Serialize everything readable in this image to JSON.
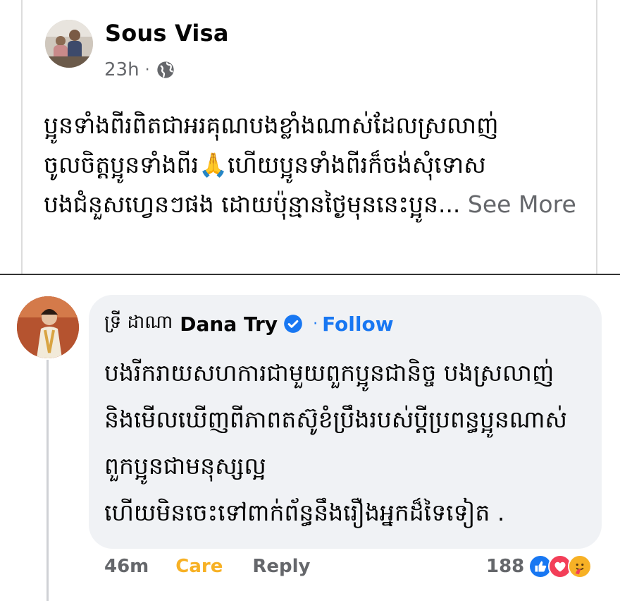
{
  "post": {
    "author": "Sous Visa",
    "time": "23h",
    "meta_separator": "·",
    "privacy_icon": "globe-icon",
    "text_lines": [
      "ប្អូនទាំងពីរពិតជាអរគុណបងខ្លាំងណាស់ដែលស្រលាញ់",
      "ចូលចិត្តប្អូនទាំងពីរ🙏ហើយប្អូនទាំងពីរក៏ចង់សុំទោស",
      "បងជំនួសហ្វេនៗផង ដោយប៉ុន្មានថ្ងៃមុននេះប្អូន..."
    ],
    "see_more": "See More"
  },
  "comment": {
    "native_name": "ទ្រី ដាណា",
    "name": "Dana Try",
    "verified_icon": "verified-badge-icon",
    "follow_separator": "·",
    "follow": "Follow",
    "lines": [
      "បងរីករាយសហការជាមួយពួកប្អូនជានិច្ច បងស្រលាញ់",
      "និងមើលឃើញពីភាពតស៊ូខំប្រឹងរបស់ប្ដីប្រពន្ធប្អូនណាស់",
      "ពួកប្អូនជាមនុស្សល្អ",
      "ហើយមិនចេះទៅពាក់ព័ន្ធនឹងរឿងអ្នកដ៏ទៃទៀត ."
    ],
    "time": "46m",
    "care": "Care",
    "reply": "Reply",
    "reaction_count": "188",
    "reaction_icons": [
      "like-icon",
      "love-icon",
      "care-icon"
    ]
  },
  "colors": {
    "accent": "#1877f2",
    "care": "#f7b125",
    "secondary_text": "#65676b",
    "bubble": "#f0f2f5"
  }
}
